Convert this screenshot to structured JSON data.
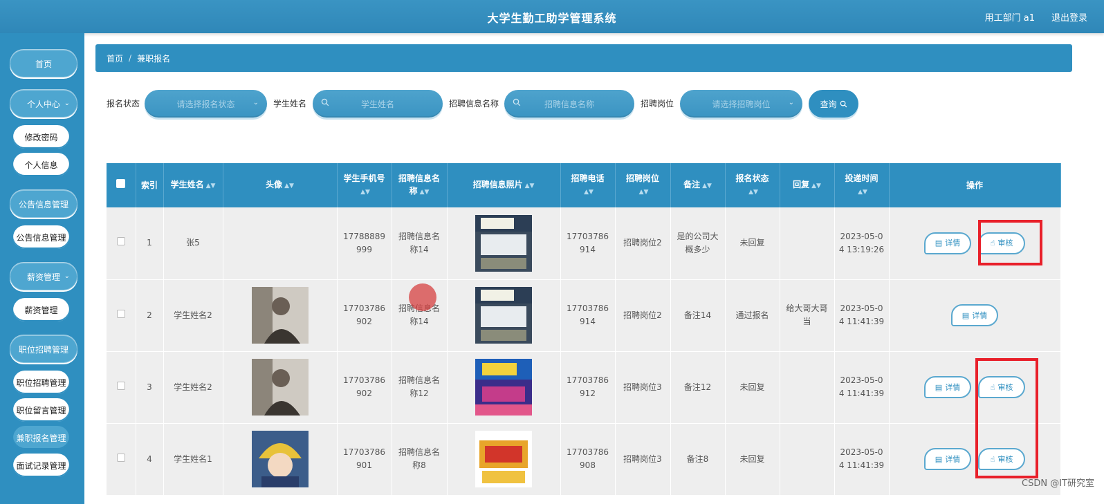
{
  "header": {
    "title": "大学生勤工助学管理系统",
    "user": "用工部门 a1",
    "logout": "退出登录"
  },
  "sidebar": {
    "items": [
      {
        "label": "首页"
      },
      {
        "label": "个人中心"
      },
      {
        "label": "修改密码"
      },
      {
        "label": "个人信息"
      },
      {
        "label": "公告信息管理"
      },
      {
        "label": "公告信息管理"
      },
      {
        "label": "薪资管理"
      },
      {
        "label": "薪资管理"
      },
      {
        "label": "职位招聘管理"
      },
      {
        "label": "职位招聘管理"
      },
      {
        "label": "职位留言管理"
      },
      {
        "label": "兼职报名管理"
      },
      {
        "label": "面试记录管理"
      }
    ]
  },
  "breadcrumb": {
    "home": "首页",
    "separator": "/",
    "current": "兼职报名"
  },
  "filters": {
    "status_label": "报名状态",
    "status_placeholder": "请选择报名状态",
    "name_label": "学生姓名",
    "name_placeholder": "学生姓名",
    "info_label": "招聘信息名称",
    "info_placeholder": "招聘信息名称",
    "post_label": "招聘岗位",
    "post_placeholder": "请选择招聘岗位",
    "query_label": "查询"
  },
  "table": {
    "headers": [
      "索引",
      "学生姓名",
      "头像",
      "学生手机号",
      "招聘信息名称",
      "招聘信息照片",
      "招聘电话",
      "招聘岗位",
      "备注",
      "报名状态",
      "回复",
      "投递时间",
      "操作"
    ],
    "detail_label": "详情",
    "audit_label": "审核",
    "rows": [
      {
        "index": "1",
        "name": "张5",
        "phone": "17788889999",
        "info": "招聘信息名称14",
        "tel": "17703786914",
        "post": "招聘岗位2",
        "note": "是的公司大概多少",
        "status": "未回复",
        "reply": "",
        "time": "2023-05-04 13:19:26"
      },
      {
        "index": "2",
        "name": "学生姓名2",
        "phone": "17703786902",
        "info": "招聘信息名称14",
        "tel": "17703786914",
        "post": "招聘岗位2",
        "note": "备注14",
        "status": "通过报名",
        "reply": "给大哥大哥当",
        "time": "2023-05-04 11:41:39"
      },
      {
        "index": "3",
        "name": "学生姓名2",
        "phone": "17703786902",
        "info": "招聘信息名称12",
        "tel": "17703786912",
        "post": "招聘岗位3",
        "note": "备注12",
        "status": "未回复",
        "reply": "",
        "time": "2023-05-04 11:41:39"
      },
      {
        "index": "4",
        "name": "学生姓名1",
        "phone": "17703786901",
        "info": "招聘信息名称8",
        "tel": "17703786908",
        "post": "招聘岗位3",
        "note": "备注8",
        "status": "未回复",
        "reply": "",
        "time": "2023-05-04 11:41:39"
      }
    ]
  },
  "watermark": "CSDN @IT研究室",
  "colors": {
    "primary": "#2f8fc0",
    "highlight": "#e8202a"
  }
}
